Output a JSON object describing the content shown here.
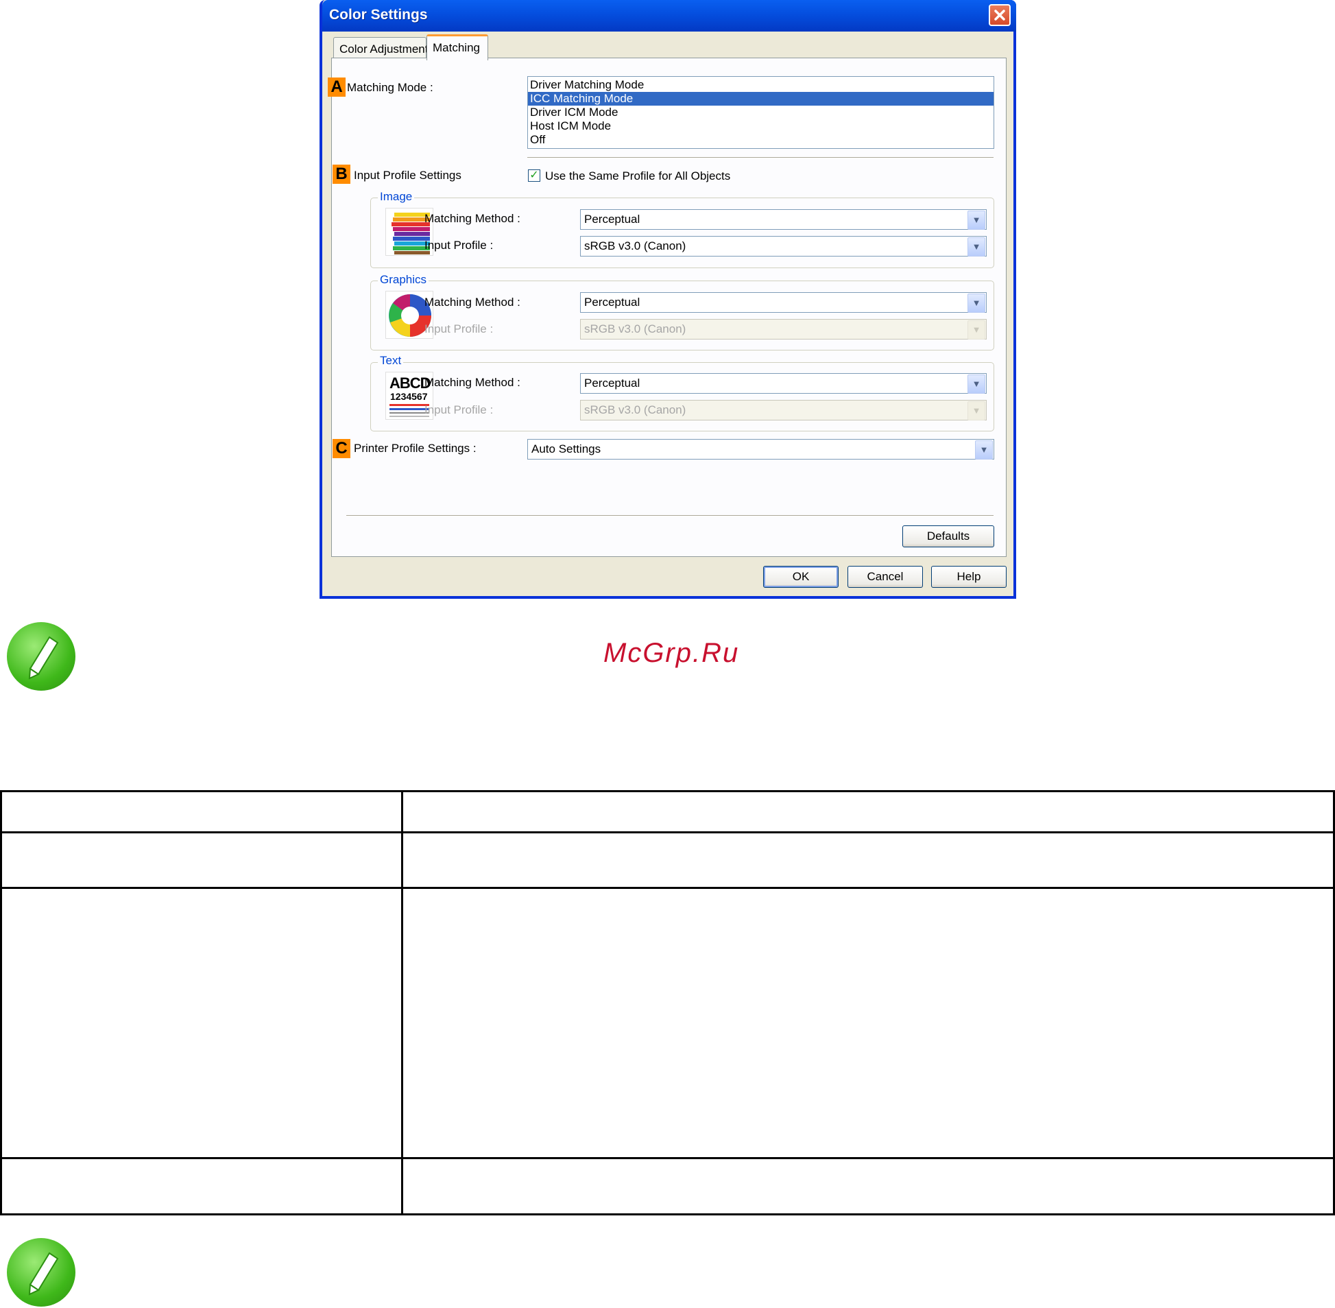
{
  "dialog": {
    "title": "Color Settings",
    "tabs": [
      {
        "label": "Color Adjustment",
        "active": false
      },
      {
        "label": "Matching",
        "active": true
      }
    ],
    "matching_mode": {
      "marker": "A",
      "label": "Matching Mode :",
      "options": [
        "Driver Matching Mode",
        "ICC Matching Mode",
        "Driver ICM Mode",
        "Host ICM Mode",
        "Off"
      ],
      "selected": "ICC Matching Mode"
    },
    "input_profile": {
      "marker": "B",
      "label": "Input Profile Settings",
      "same_profile_label": "Use the Same Profile for All Objects",
      "same_profile_checked": true,
      "check_glyph": "✓"
    },
    "groups": {
      "image": {
        "title": "Image",
        "method_label": "Matching Method :",
        "method_value": "Perceptual",
        "profile_label": "Input Profile :",
        "profile_value": "sRGB v3.0 (Canon)"
      },
      "graphics": {
        "title": "Graphics",
        "method_label": "Matching Method :",
        "method_value": "Perceptual",
        "profile_label": "Input Profile :",
        "profile_value": "sRGB v3.0 (Canon)"
      },
      "text": {
        "title": "Text",
        "method_label": "Matching Method :",
        "method_value": "Perceptual",
        "profile_label": "Input Profile :",
        "profile_value": "sRGB v3.0 (Canon)",
        "thumb_line1": "ABCD",
        "thumb_line2": "1234567"
      }
    },
    "printer_profile": {
      "marker": "C",
      "label": "Printer Profile Settings :",
      "value": "Auto Settings"
    },
    "buttons": {
      "defaults": "Defaults",
      "ok": "OK",
      "cancel": "Cancel",
      "help": "Help"
    }
  },
  "watermark": "McGrp.Ru",
  "colors": {
    "titlebar": "#0550e0",
    "selection": "#316ac5",
    "marker": "#ff8c00",
    "group_title": "#0046d5",
    "watermark": "#c8102e",
    "note_icon": "#3fb81a"
  }
}
